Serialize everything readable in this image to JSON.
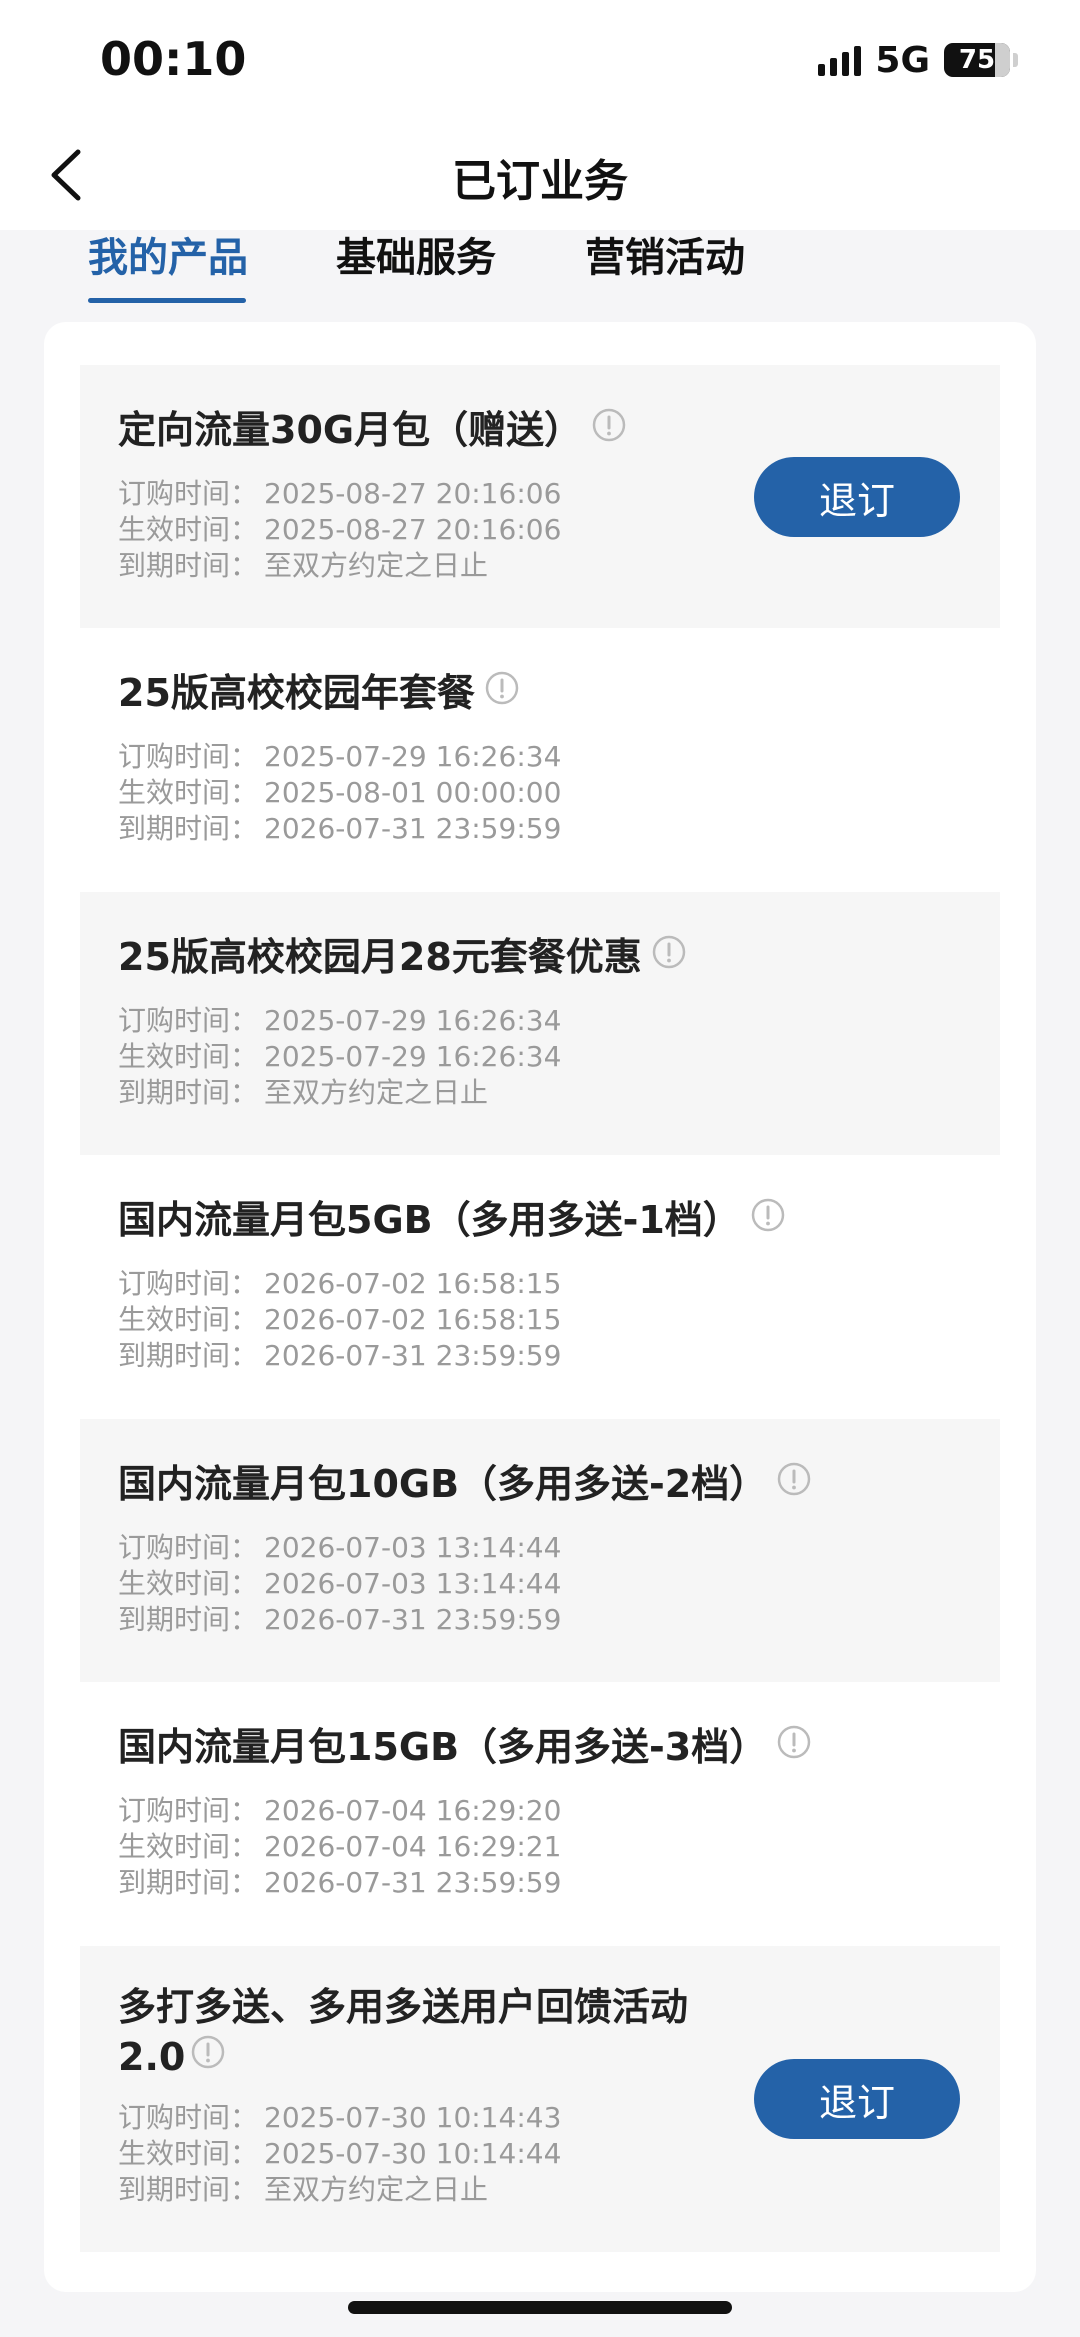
{
  "status_bar": {
    "time": "00:10",
    "network": "5G",
    "battery": "75",
    "icons": [
      "signal-icon",
      "battery-icon"
    ]
  },
  "nav": {
    "back_icon": "chevron-left-icon",
    "title": "已订业务"
  },
  "tabs": [
    {
      "label": "我的产品",
      "active": true
    },
    {
      "label": "基础服务",
      "active": false
    },
    {
      "label": "营销活动",
      "active": false
    }
  ],
  "labels": {
    "order": "订购时间：",
    "effective": "生效时间：",
    "expire": "到期时间："
  },
  "products": [
    {
      "name": "定向流量30G月包（赠送）",
      "order_time": "2025-08-27 20:16:06",
      "effective_time": "2025-08-27 20:16:06",
      "expire_time": "至双方约定之日止",
      "action": "退订"
    },
    {
      "name": "25版高校校园年套餐",
      "order_time": "2025-07-29 16:26:34",
      "effective_time": "2025-08-01 00:00:00",
      "expire_time": "2026-07-31 23:59:59"
    },
    {
      "name": "25版高校校园月28元套餐优惠",
      "order_time": "2025-07-29 16:26:34",
      "effective_time": "2025-07-29 16:26:34",
      "expire_time": "至双方约定之日止"
    },
    {
      "name": "国内流量月包5GB（多用多送-1档）",
      "order_time": "2026-07-02 16:58:15",
      "effective_time": "2026-07-02 16:58:15",
      "expire_time": "2026-07-31 23:59:59"
    },
    {
      "name": "国内流量月包10GB（多用多送-2档）",
      "order_time": "2026-07-03 13:14:44",
      "effective_time": "2026-07-03 13:14:44",
      "expire_time": "2026-07-31 23:59:59"
    },
    {
      "name": "国内流量月包15GB（多用多送-3档）",
      "order_time": "2026-07-04 16:29:20",
      "effective_time": "2026-07-04 16:29:21",
      "expire_time": "2026-07-31 23:59:59"
    },
    {
      "name_line1": "多打多送、多用多送用户回馈活动",
      "name_line2": "2.0",
      "order_time": "2025-07-30 10:14:43",
      "effective_time": "2025-07-30 10:14:44",
      "expire_time": "至双方约定之日止",
      "action": "退订"
    }
  ],
  "colors": {
    "accent": "#2462a8",
    "page_bg": "#f5f5f7",
    "card_shaded": "#f6f6f6",
    "meta_text": "#9a9a9a"
  }
}
